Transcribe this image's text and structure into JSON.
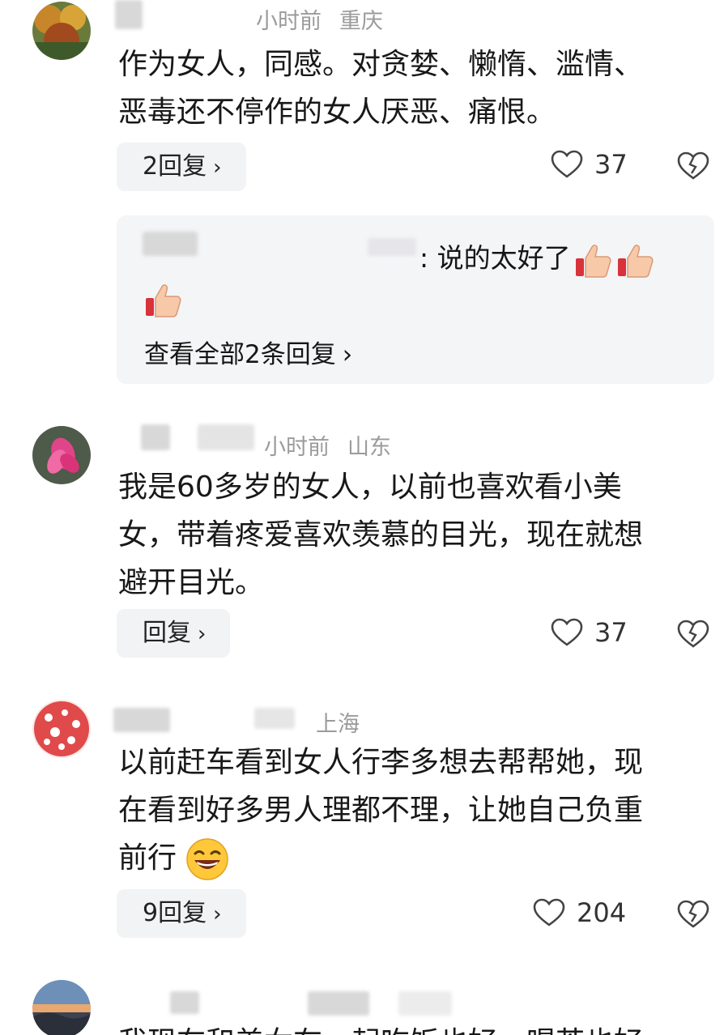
{
  "comments": [
    {
      "time": "小时前",
      "location": "重庆",
      "text_lines": [
        "作为女人，同感。对贪婪、懒惰、滥情、",
        "恶毒还不停作的女人厌恶、痛恨。"
      ],
      "reply_label": "2回复",
      "likes": "37",
      "subreply": {
        "text": ": 说的太好了",
        "view_all": "查看全部2条回复"
      }
    },
    {
      "time": "小时前",
      "location": "山东",
      "text_lines": [
        "我是60多岁的女人，以前也喜欢看小美",
        "女，带着疼爱喜欢羡慕的目光，现在就想",
        "避开目光。"
      ],
      "reply_label": "回复",
      "likes": "37"
    },
    {
      "time": "",
      "location": "上海",
      "text_lines": [
        "以前赶车看到女人行李多想去帮帮她，现",
        "在看到好多男人理都不理，让她自己负重",
        "前行"
      ],
      "reply_label": "9回复",
      "likes": "204"
    },
    {
      "text_lines": [
        "我现在和美女在一起吃饭也好，喝茶也好"
      ]
    }
  ],
  "icons": {
    "like": "heart-outline-icon",
    "dislike": "broken-heart-icon",
    "chevron": "chevron-right-icon",
    "thumbs_up": "thumbs-up-emoji",
    "laugh": "laughing-emoji"
  },
  "colors": {
    "meta": "#9b9b9b",
    "reply_bg": "#f2f3f5",
    "subbox_bg": "#f4f5f7"
  }
}
